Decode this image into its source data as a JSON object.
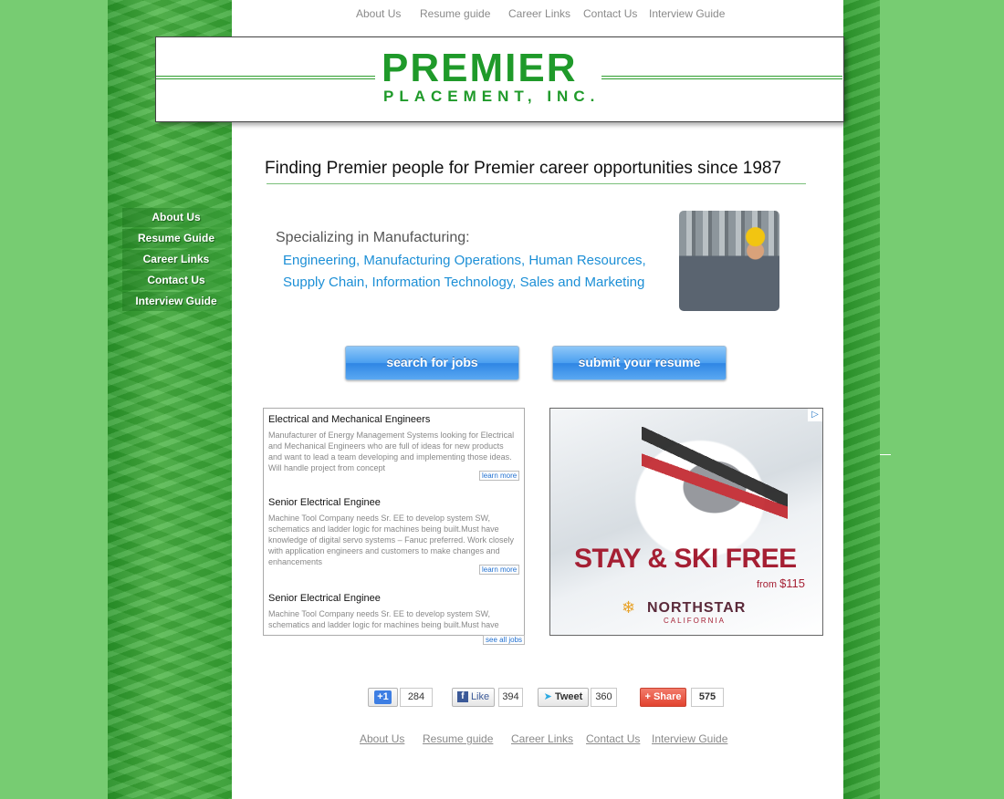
{
  "top_nav": [
    "About Us",
    "Resume guide",
    "Career Links",
    "Contact Us",
    "Interview Guide"
  ],
  "logo": {
    "main": "PREMIER",
    "sub": "PLACEMENT, INC."
  },
  "side_nav": [
    "About Us",
    "Resume Guide",
    "Career Links",
    "Contact Us",
    "Interview Guide"
  ],
  "tagline": "Finding Premier people for Premier career opportunities since 1987",
  "specialties": {
    "heading": "Specializing in Manufacturing:",
    "line1": "Engineering, Manufacturing Operations, Human Resources,",
    "line2": "Supply Chain, Information Technology, Sales and Marketing"
  },
  "buttons": {
    "search": "search for jobs",
    "submit": "submit your resume"
  },
  "jobs": [
    {
      "title": "Electrical and Mechanical Engineers",
      "description": "Manufacturer of Energy Management Systems looking for Electrical and Mechanical Engineers who are full of ideas for new products and want to lead a team developing and implementing those ideas. Will handle project from concept"
    },
    {
      "title": "Senior Electrical Enginee",
      "description": "Machine Tool Company needs Sr. EE to develop system SW, schematics and ladder logic for machines being built.Must have knowledge of digital servo systems – Fanuc preferred. Work closely with application engineers and customers to make changes and enhancements"
    },
    {
      "title": "Senior Electrical Enginee",
      "description": "Machine Tool Company needs Sr. EE to develop system SW, schematics and ladder logic for machines being built.Must have"
    }
  ],
  "jobs_links": {
    "learn_more": "learn more",
    "see_all": "see all jobs"
  },
  "ad": {
    "headline": "STAY & SKI FREE",
    "price_prefix": "from ",
    "price": "$115",
    "brand": "NORTHSTAR",
    "brand_sub": "CALIFORNIA",
    "choices_icon": "adchoices-icon"
  },
  "social": {
    "gplus": {
      "label": "+1",
      "count": "284"
    },
    "facebook": {
      "label": "Like",
      "count": "394"
    },
    "twitter": {
      "label": "Tweet",
      "count": "360"
    },
    "share": {
      "label": "Share",
      "count": "575"
    }
  },
  "bottom_nav": [
    "About Us",
    "Resume guide",
    "Career Links",
    "Contact Us",
    "Interview Guide"
  ],
  "colors": {
    "background": "#77cc72",
    "brand_green": "#1f9a2a",
    "specialty_blue": "#1c8fd6",
    "ad_red": "#a51f33"
  }
}
